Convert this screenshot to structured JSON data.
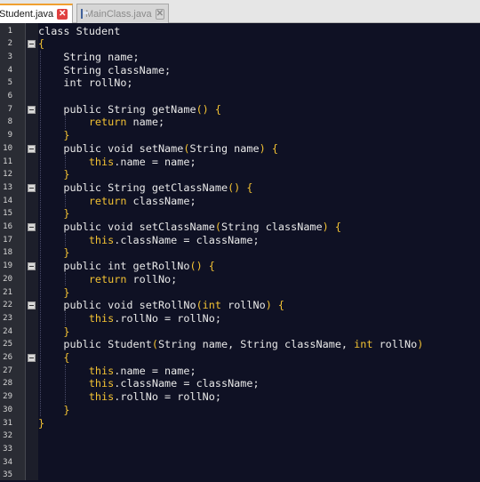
{
  "tabs": [
    {
      "label": "Student.java",
      "active": true
    },
    {
      "label": "MainClass.java",
      "active": false
    }
  ],
  "icons": {
    "file": "java-file-icon",
    "close": "close-tab-icon",
    "fold": "fold-minus-icon"
  },
  "colors": {
    "background": "#0f1124",
    "keyword": "#f3c233",
    "text": "#e8e8e8",
    "gutter": "#2a2c34"
  },
  "line_numbers": [
    "1",
    "2",
    "3",
    "4",
    "5",
    "6",
    "7",
    "8",
    "9",
    "10",
    "11",
    "12",
    "13",
    "14",
    "15",
    "16",
    "17",
    "18",
    "19",
    "20",
    "21",
    "22",
    "23",
    "24",
    "25",
    "26",
    "27",
    "28",
    "29",
    "30",
    "31",
    "32",
    "33",
    "34",
    "35"
  ],
  "fold_lines": [
    2,
    7,
    10,
    13,
    16,
    19,
    22,
    26
  ],
  "code": [
    [
      {
        "t": "id",
        "v": "class Student"
      }
    ],
    [
      {
        "t": "br",
        "v": "{"
      }
    ],
    [
      {
        "t": "id",
        "v": "    String name;"
      }
    ],
    [
      {
        "t": "id",
        "v": "    String className;"
      }
    ],
    [
      {
        "t": "id",
        "v": "    int rollNo;"
      }
    ],
    [],
    [
      {
        "t": "id",
        "v": "    public String getName"
      },
      {
        "t": "op",
        "v": "() {"
      }
    ],
    [
      {
        "t": "kw",
        "v": "        return "
      },
      {
        "t": "id",
        "v": "name;"
      }
    ],
    [
      {
        "t": "br",
        "v": "    }"
      }
    ],
    [
      {
        "t": "id",
        "v": "    public void setName"
      },
      {
        "t": "op",
        "v": "("
      },
      {
        "t": "id",
        "v": "String name"
      },
      {
        "t": "op",
        "v": ") {"
      }
    ],
    [
      {
        "t": "kw",
        "v": "        this"
      },
      {
        "t": "id",
        "v": ".name = name;"
      }
    ],
    [
      {
        "t": "br",
        "v": "    }"
      }
    ],
    [
      {
        "t": "id",
        "v": "    public String getClassName"
      },
      {
        "t": "op",
        "v": "() {"
      }
    ],
    [
      {
        "t": "kw",
        "v": "        return "
      },
      {
        "t": "id",
        "v": "className;"
      }
    ],
    [
      {
        "t": "br",
        "v": "    }"
      }
    ],
    [
      {
        "t": "id",
        "v": "    public void setClassName"
      },
      {
        "t": "op",
        "v": "("
      },
      {
        "t": "id",
        "v": "String className"
      },
      {
        "t": "op",
        "v": ") {"
      }
    ],
    [
      {
        "t": "kw",
        "v": "        this"
      },
      {
        "t": "id",
        "v": ".className = className;"
      }
    ],
    [
      {
        "t": "br",
        "v": "    }"
      }
    ],
    [
      {
        "t": "id",
        "v": "    public int getRollNo"
      },
      {
        "t": "op",
        "v": "() {"
      }
    ],
    [
      {
        "t": "kw",
        "v": "        return "
      },
      {
        "t": "id",
        "v": "rollNo;"
      }
    ],
    [
      {
        "t": "br",
        "v": "    }"
      }
    ],
    [
      {
        "t": "id",
        "v": "    public void setRollNo"
      },
      {
        "t": "op",
        "v": "("
      },
      {
        "t": "kw",
        "v": "int "
      },
      {
        "t": "id",
        "v": "rollNo"
      },
      {
        "t": "op",
        "v": ") {"
      }
    ],
    [
      {
        "t": "kw",
        "v": "        this"
      },
      {
        "t": "id",
        "v": ".rollNo = rollNo;"
      }
    ],
    [
      {
        "t": "br",
        "v": "    }"
      }
    ],
    [
      {
        "t": "id",
        "v": "    public Student"
      },
      {
        "t": "op",
        "v": "("
      },
      {
        "t": "id",
        "v": "String name, String className, "
      },
      {
        "t": "kw",
        "v": "int "
      },
      {
        "t": "id",
        "v": "rollNo"
      },
      {
        "t": "op",
        "v": ")"
      }
    ],
    [
      {
        "t": "br",
        "v": "    {"
      }
    ],
    [
      {
        "t": "kw",
        "v": "        this"
      },
      {
        "t": "id",
        "v": ".name = name;"
      }
    ],
    [
      {
        "t": "kw",
        "v": "        this"
      },
      {
        "t": "id",
        "v": ".className = className;"
      }
    ],
    [
      {
        "t": "kw",
        "v": "        this"
      },
      {
        "t": "id",
        "v": ".rollNo = rollNo;"
      }
    ],
    [
      {
        "t": "br",
        "v": "    }"
      }
    ],
    [
      {
        "t": "br",
        "v": "}"
      }
    ],
    [],
    [],
    [],
    []
  ]
}
